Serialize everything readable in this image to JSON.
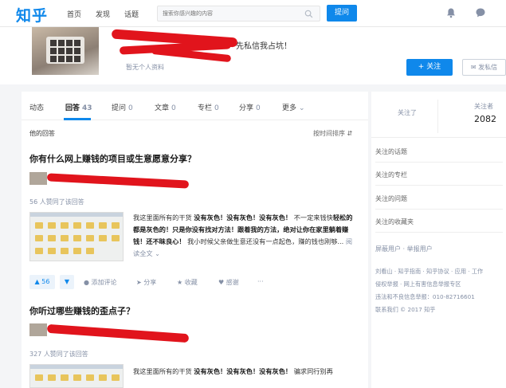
{
  "nav": {
    "logo": "知乎",
    "links": [
      "首页",
      "发现",
      "话题"
    ],
    "search_placeholder": "搜索你感兴趣的内容",
    "ask_label": "提问"
  },
  "profile": {
    "bio": "先私信我占坑！",
    "no_info": "暂无个人资料",
    "follow_label": "+ 关注",
    "message_label": "发私信"
  },
  "tabs": [
    {
      "label": "动态",
      "count": ""
    },
    {
      "label": "回答",
      "count": "43"
    },
    {
      "label": "提问",
      "count": "0"
    },
    {
      "label": "文章",
      "count": "0"
    },
    {
      "label": "专栏",
      "count": "0"
    },
    {
      "label": "分享",
      "count": "0"
    },
    {
      "label": "更多",
      "count": ""
    }
  ],
  "answers_header": {
    "title": "他的回答",
    "sort": "按时间排序"
  },
  "answers": [
    {
      "question": "你有什么网上赚钱的项目或生意愿意分享？",
      "likes": "56 人赞同了该回答",
      "excerpt_intro": "我这里面所有的干货 ",
      "excerpt_bold1": "没有灰色！没有灰色！没有灰色！",
      "excerpt_mid": " 不一定来钱快",
      "excerpt_bold2": "轻松的都是灰色的！只是你没有找对方法！跟着我的方法，绝对让你在家里躺着赚钱！还不昧良心！",
      "excerpt_tail": " 我小时候父亲做生意还没有一点起色，赚的钱也刚够...",
      "read_all": "阅读全文",
      "vote_count": "56",
      "comment": "添加评论",
      "share": "分享",
      "collect": "收藏",
      "thanks": "感谢",
      "more": "···"
    },
    {
      "question": "你听过哪些赚钱的歪点子？",
      "likes": "327 人赞同了该回答",
      "excerpt_intro": "我这里面所有的干货 ",
      "excerpt_bold1": "没有灰色！没有灰色！没有灰色！",
      "excerpt_mid": " 骗求同行别再"
    }
  ],
  "sidebar": {
    "following_label": "关注了",
    "followers_label": "关注者",
    "followers_count": "2082",
    "links": [
      "关注的话题",
      "关注的专栏",
      "关注的问题",
      "关注的收藏夹"
    ],
    "block_report": "屏蔽用户 · 举报用户",
    "footer": [
      "刘看山 · 知乎指南 · 知乎协议 · 应用 · 工作",
      "侵权举报 · 网上有害信息举报专区",
      "违法和不良信息举报：010-82716601",
      "联系我们 © 2017 知乎"
    ]
  },
  "colors": {
    "brand": "#0f88eb",
    "scribble": "#e1141c"
  }
}
